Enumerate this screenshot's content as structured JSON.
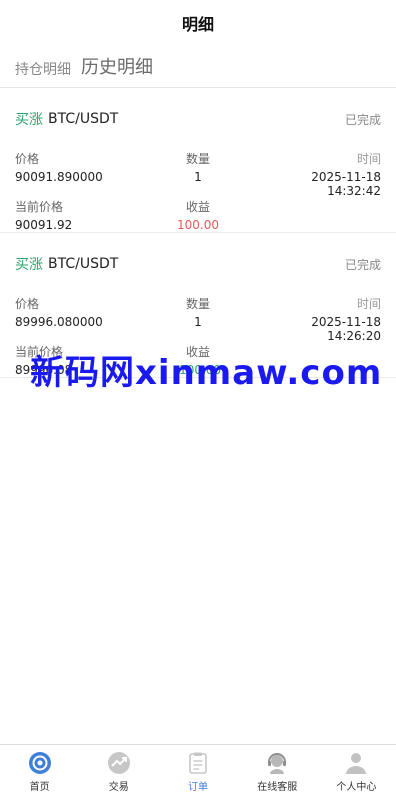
{
  "header": {
    "title": "明细"
  },
  "tabs": [
    {
      "label": "持仓明细"
    },
    {
      "label": "历史明细"
    }
  ],
  "orders": [
    {
      "side": "买涨",
      "pair": "BTC/USDT",
      "status": "已完成",
      "price_label": "价格",
      "qty_label": "数量",
      "time_label": "时间",
      "price": "90091.890000",
      "qty": "1",
      "time": "2025-11-18 14:32:42",
      "current_label": "当前价格",
      "profit_label": "收益",
      "current_price": "90091.92",
      "profit": "100.00"
    },
    {
      "side": "买涨",
      "pair": "BTC/USDT",
      "status": "已完成",
      "price_label": "价格",
      "qty_label": "数量",
      "time_label": "时间",
      "price": "89996.080000",
      "qty": "1",
      "time": "2025-11-18 14:26:20",
      "current_label": "当前价格",
      "profit_label": "收益",
      "current_price": "89996.08",
      "profit": "-100.00"
    }
  ],
  "watermark": "新码网xinmaw.com",
  "tabbar": [
    {
      "label": "首页",
      "icon": "home-icon"
    },
    {
      "label": "交易",
      "icon": "trade-icon"
    },
    {
      "label": "订单",
      "icon": "order-icon"
    },
    {
      "label": "在线客服",
      "icon": "support-icon"
    },
    {
      "label": "个人中心",
      "icon": "user-icon"
    }
  ],
  "colors": {
    "accent": "#3f7fd8",
    "up": "#2aa56c",
    "profit_positive": "#e85b5b",
    "watermark": "#1a1af0"
  }
}
